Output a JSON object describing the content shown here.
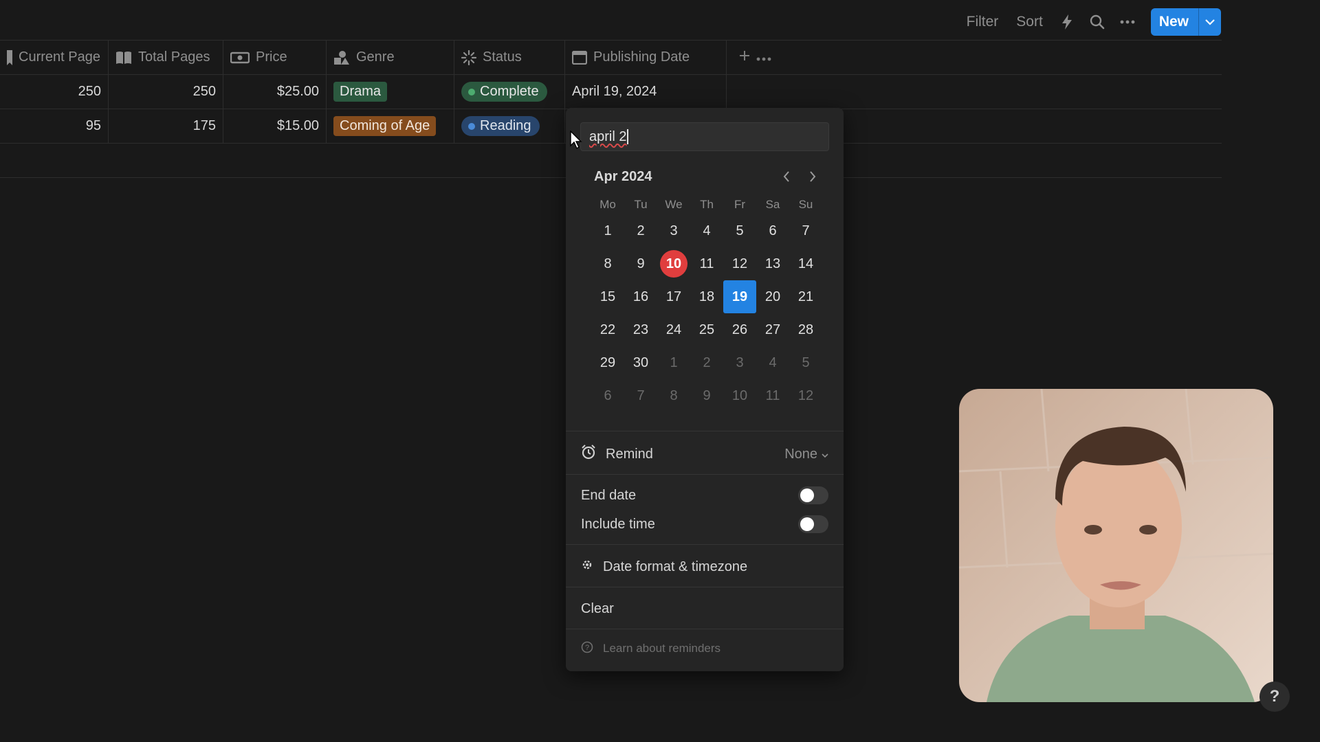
{
  "toolbar": {
    "filter_label": "Filter",
    "sort_label": "Sort",
    "new_label": "New",
    "accent": "#2383e2"
  },
  "columns": [
    {
      "label": "Current Page",
      "icon": "bookmark-icon"
    },
    {
      "label": "Total Pages",
      "icon": "book-icon"
    },
    {
      "label": "Price",
      "icon": "money-icon"
    },
    {
      "label": "Genre",
      "icon": "shapes-icon"
    },
    {
      "label": "Status",
      "icon": "loading-icon"
    },
    {
      "label": "Publishing Date",
      "icon": "calendar-icon"
    }
  ],
  "rows": [
    {
      "current_page": "250",
      "total_pages": "250",
      "price": "$25.00",
      "genre": "Drama",
      "status": "Complete",
      "publishing_date": "April 19, 2024"
    },
    {
      "current_page": "95",
      "total_pages": "175",
      "price": "$15.00",
      "genre": "Coming of Age",
      "status": "Reading",
      "publishing_date": ""
    }
  ],
  "date_picker": {
    "input_value": "april 2",
    "month_label": "Apr 2024",
    "weekdays": [
      "Mo",
      "Tu",
      "We",
      "Th",
      "Fr",
      "Sa",
      "Su"
    ],
    "weeks": [
      [
        "1",
        "2",
        "3",
        "4",
        "5",
        "6",
        "7"
      ],
      [
        "8",
        "9",
        "10",
        "11",
        "12",
        "13",
        "14"
      ],
      [
        "15",
        "16",
        "17",
        "18",
        "19",
        "20",
        "21"
      ],
      [
        "22",
        "23",
        "24",
        "25",
        "26",
        "27",
        "28"
      ],
      [
        "29",
        "30",
        "1",
        "2",
        "3",
        "4",
        "5"
      ],
      [
        "6",
        "7",
        "8",
        "9",
        "10",
        "11",
        "12"
      ]
    ],
    "today": "10",
    "selected": "19",
    "remind_label": "Remind",
    "remind_value": "None",
    "end_date_label": "End date",
    "end_date_on": false,
    "include_time_label": "Include time",
    "include_time_on": false,
    "format_label": "Date format & timezone",
    "clear_label": "Clear",
    "learn_label": "Learn about reminders"
  },
  "help_label": "?"
}
